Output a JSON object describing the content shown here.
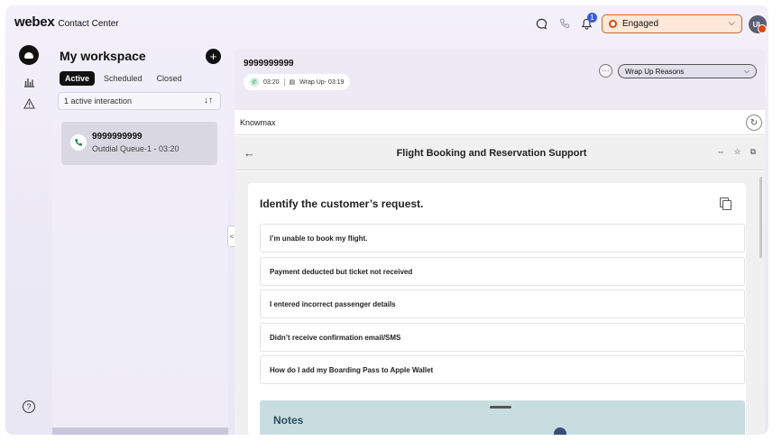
{
  "app": {
    "brand_logo": "webex",
    "brand_name": "Contact Center"
  },
  "header": {
    "notification_count": "1",
    "agent_state": "Engaged",
    "avatar_initials": "UL",
    "colors": {
      "state_accent": "#d9480f",
      "state_bg": "#fde7d6",
      "badge": "#3b5bdb"
    }
  },
  "nav": {
    "icons": [
      "home-icon",
      "stats-icon",
      "alert-icon",
      "help-icon"
    ],
    "help_glyph": "?"
  },
  "workspace": {
    "title": "My workspace",
    "add_glyph": "+",
    "tabs": [
      "Active",
      "Scheduled",
      "Closed"
    ],
    "active_tab": "Active",
    "count_label": "1 active interaction",
    "sort_glyph": "↓↑",
    "card": {
      "title": "9999999999",
      "subtitle": "Outdial Queue-1 - 03:20"
    }
  },
  "interaction": {
    "number": "9999999999",
    "call_timer": "03:20",
    "wrapup_timer": "Wrap Up- 03:19",
    "more_glyph": "···",
    "wrapup_select": "Wrap Up Reasons"
  },
  "widget": {
    "title": "Knowmax",
    "doc_title": "Flight Booking and Reservation Support",
    "question": "Identify the customer’s request.",
    "options": [
      "I’m unable to book my flight.",
      "Payment deducted but ticket not received",
      "I entered incorrect passenger details",
      "Didn’t receive confirmation email/SMS",
      "How do I add my Boarding Pass to Apple Wallet"
    ],
    "notes_title": "Notes"
  }
}
